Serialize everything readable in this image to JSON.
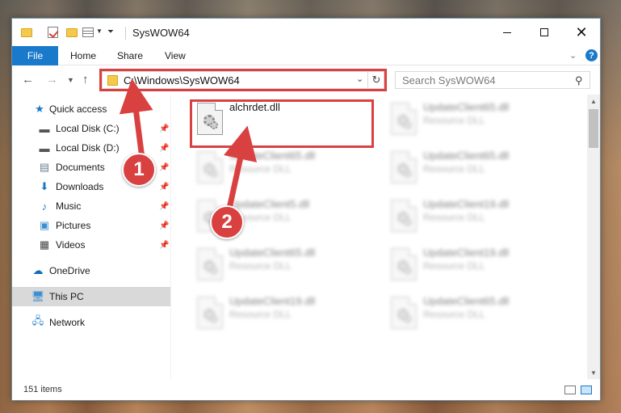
{
  "window": {
    "title": "SysWOW64",
    "controls": {
      "minimize_icon": "minimize-icon",
      "maximize_icon": "maximize-icon",
      "close_icon": "close-icon"
    }
  },
  "ribbon": {
    "file_tab": "File",
    "tabs": [
      "Home",
      "Share",
      "View"
    ],
    "help": "?"
  },
  "nav": {
    "address": "C:\\Windows\\SysWOW64",
    "search_placeholder": "Search SysWOW64"
  },
  "sidebar": {
    "items": [
      {
        "label": "Quick access",
        "icon": "star-icon",
        "pinned": false
      },
      {
        "label": "Local Disk (C:)",
        "icon": "drive-icon",
        "pinned": true
      },
      {
        "label": "Local Disk (D:)",
        "icon": "drive-icon",
        "pinned": true
      },
      {
        "label": "Documents",
        "icon": "documents-icon",
        "pinned": true
      },
      {
        "label": "Downloads",
        "icon": "download-icon",
        "pinned": true
      },
      {
        "label": "Music",
        "icon": "music-icon",
        "pinned": true
      },
      {
        "label": "Pictures",
        "icon": "pictures-icon",
        "pinned": true
      },
      {
        "label": "Videos",
        "icon": "videos-icon",
        "pinned": true
      },
      {
        "label": "OneDrive",
        "icon": "cloud-icon",
        "pinned": false
      },
      {
        "label": "This PC",
        "icon": "computer-icon",
        "pinned": false,
        "selected": true
      },
      {
        "label": "Network",
        "icon": "network-icon",
        "pinned": false
      }
    ]
  },
  "files": [
    {
      "name": "alchrdet.dll",
      "type": "",
      "blurred": false
    },
    {
      "name": "UpdateClient65.dll",
      "type": "Resource DLL",
      "blurred": true
    },
    {
      "name": "UpdateClient65.dll",
      "type": "Resource DLL",
      "blurred": true
    },
    {
      "name": "UpdateClient65.dll",
      "type": "Resource DLL",
      "blurred": true
    },
    {
      "name": "UpdateClient5.dll",
      "type": "Resource DLL",
      "blurred": true
    },
    {
      "name": "UpdateClient19.dll",
      "type": "Resource DLL",
      "blurred": true
    },
    {
      "name": "UpdateClient65.dll",
      "type": "Resource DLL",
      "blurred": true
    },
    {
      "name": "UpdateClient19.dll",
      "type": "Resource DLL",
      "blurred": true
    },
    {
      "name": "UpdateClient19.dll",
      "type": "Resource DLL",
      "blurred": true
    },
    {
      "name": "UpdateClient65.dll",
      "type": "Resource DLL",
      "blurred": true
    }
  ],
  "status": {
    "count": "151 items"
  },
  "annotations": {
    "step1": "1",
    "step2": "2",
    "color": "#d94141"
  }
}
